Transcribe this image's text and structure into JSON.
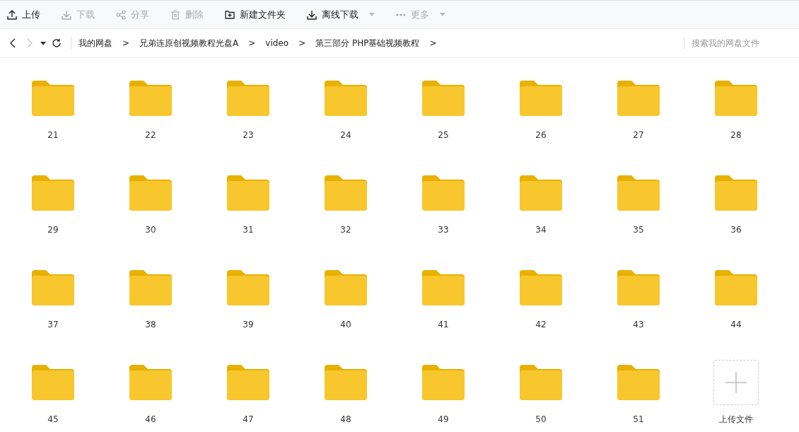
{
  "toolbar": [
    {
      "kind": "upload",
      "label": "上传",
      "disabled": false,
      "dropdown": false
    },
    {
      "kind": "download",
      "label": "下载",
      "disabled": true,
      "dropdown": false
    },
    {
      "kind": "share",
      "label": "分享",
      "disabled": true,
      "dropdown": false
    },
    {
      "kind": "delete",
      "label": "删除",
      "disabled": true,
      "dropdown": false
    },
    {
      "kind": "new-folder",
      "label": "新建文件夹",
      "disabled": false,
      "dropdown": false
    },
    {
      "kind": "offline-download",
      "label": "离线下载",
      "disabled": false,
      "dropdown": true
    },
    {
      "kind": "more",
      "label": "更多",
      "disabled": true,
      "dropdown": true
    }
  ],
  "nav": {
    "back_disabled": false,
    "forward_disabled": true
  },
  "breadcrumbs": [
    {
      "label": "我的网盘",
      "separator": ">"
    },
    {
      "label": "兄弟连原创视频教程光盘A",
      "separator": ">"
    },
    {
      "label": "video",
      "separator": ">"
    },
    {
      "label": "第三部分 PHP基础视频教程",
      "separator": ">"
    }
  ],
  "search": {
    "placeholder": "搜索我的网盘文件"
  },
  "items": [
    {
      "kind": "folder",
      "name": "21"
    },
    {
      "kind": "folder",
      "name": "22"
    },
    {
      "kind": "folder",
      "name": "23"
    },
    {
      "kind": "folder",
      "name": "24"
    },
    {
      "kind": "folder",
      "name": "25"
    },
    {
      "kind": "folder",
      "name": "26"
    },
    {
      "kind": "folder",
      "name": "27"
    },
    {
      "kind": "folder",
      "name": "28"
    },
    {
      "kind": "folder",
      "name": "29"
    },
    {
      "kind": "folder",
      "name": "30"
    },
    {
      "kind": "folder",
      "name": "31"
    },
    {
      "kind": "folder",
      "name": "32"
    },
    {
      "kind": "folder",
      "name": "33"
    },
    {
      "kind": "folder",
      "name": "34"
    },
    {
      "kind": "folder",
      "name": "35"
    },
    {
      "kind": "folder",
      "name": "36"
    },
    {
      "kind": "folder",
      "name": "37"
    },
    {
      "kind": "folder",
      "name": "38"
    },
    {
      "kind": "folder",
      "name": "39"
    },
    {
      "kind": "folder",
      "name": "40"
    },
    {
      "kind": "folder",
      "name": "41"
    },
    {
      "kind": "folder",
      "name": "42"
    },
    {
      "kind": "folder",
      "name": "43"
    },
    {
      "kind": "folder",
      "name": "44"
    },
    {
      "kind": "folder",
      "name": "45"
    },
    {
      "kind": "folder",
      "name": "46"
    },
    {
      "kind": "folder",
      "name": "47"
    },
    {
      "kind": "folder",
      "name": "48"
    },
    {
      "kind": "folder",
      "name": "49"
    },
    {
      "kind": "folder",
      "name": "50"
    },
    {
      "kind": "folder",
      "name": "51"
    },
    {
      "kind": "upload",
      "name": "上传文件"
    }
  ]
}
